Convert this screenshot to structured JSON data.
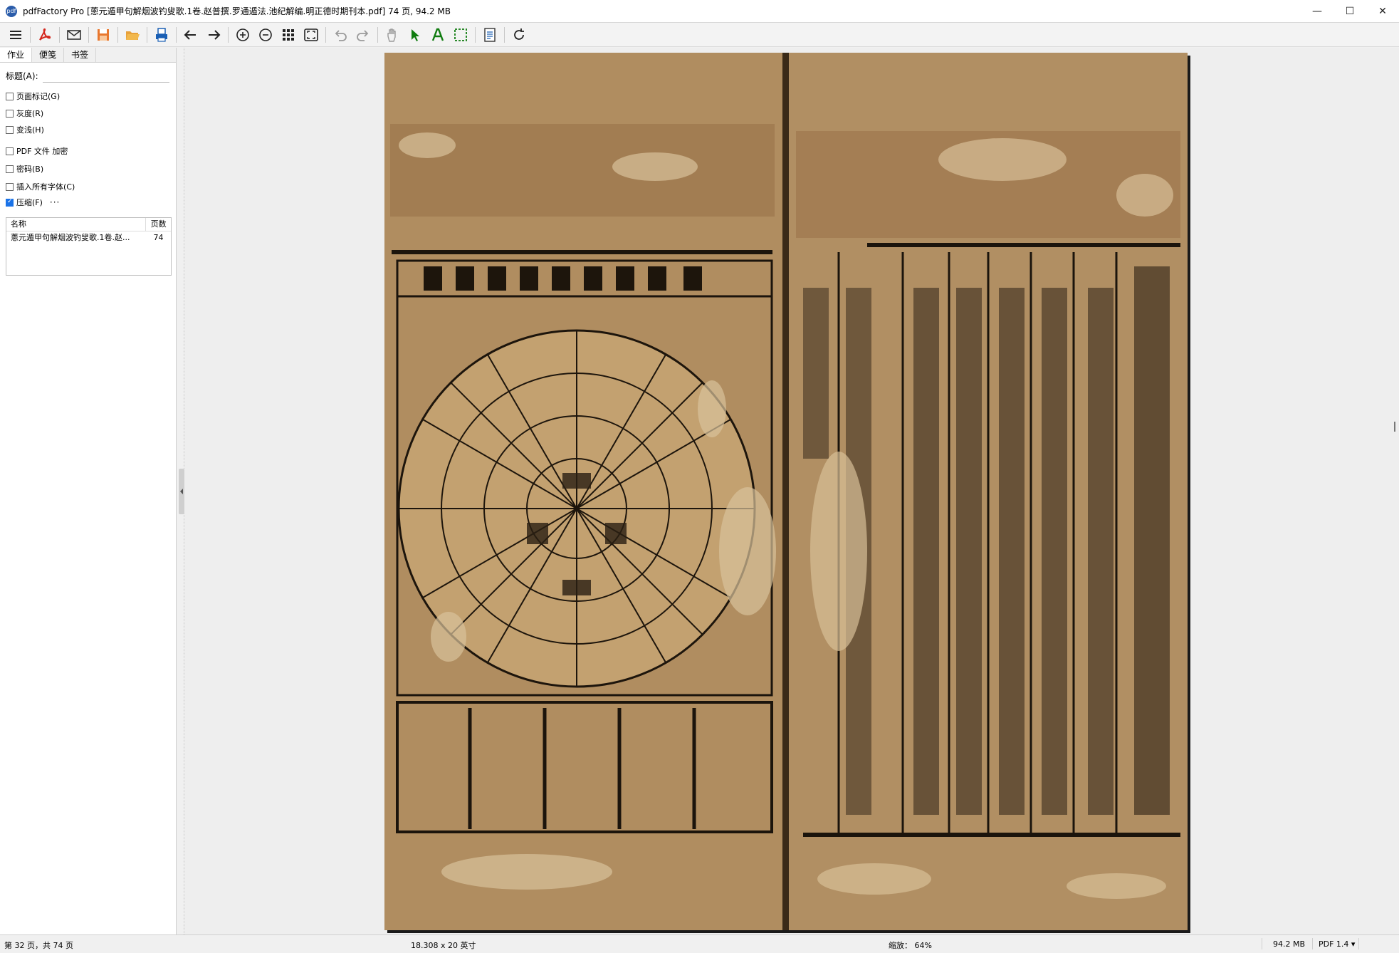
{
  "window": {
    "app_icon_text": "pdf",
    "title": "pdfFactory Pro [蔥元遁甲句解烟波钓叟歌.1卷.赵普撰.罗通遁法.池纪解编.明正德时期刊本.pdf] 74 页, 94.2 MB",
    "minimize": "—",
    "maximize": "☐",
    "close": "✕"
  },
  "toolbar": {
    "icons": [
      "menu-icon",
      "pdf-icon",
      "email-icon",
      "save-icon",
      "open-folder-icon",
      "print-icon",
      "back-arrow-icon",
      "forward-arrow-icon",
      "zoom-in-icon",
      "zoom-out-icon",
      "grid-icon",
      "fit-page-icon",
      "undo-icon",
      "redo-icon",
      "hand-tool-icon",
      "select-tool-icon",
      "text-tool-icon",
      "region-tool-icon",
      "notes-icon",
      "refresh-icon"
    ]
  },
  "left_panel": {
    "tabs": [
      "作业",
      "便笺",
      "书签"
    ],
    "title_label": "标题(A):",
    "title_value": "",
    "options": [
      {
        "label": "页面标记(G)",
        "checked": false
      },
      {
        "label": "灰度(R)",
        "checked": false
      },
      {
        "label": "变浅(H)",
        "checked": false
      },
      {
        "label": "PDF 文件 加密",
        "checked": false
      },
      {
        "label": "密码(B)",
        "checked": false
      },
      {
        "label": "插入所有字体(C)",
        "checked": false
      },
      {
        "label": "压缩(F)",
        "checked": true
      }
    ],
    "more_label": "···",
    "file_list": {
      "col_name": "名称",
      "col_pages": "页数",
      "rows": [
        {
          "name": "蔥元遁甲句解烟波钓叟歌.1卷.赵...",
          "pages": "74"
        }
      ]
    }
  },
  "status": {
    "page": "第 32 页，共 74 页",
    "size": "18.308 x 20 英寸",
    "zoom": "缩放： 64%",
    "filesize": "94.2 MB",
    "pdf_version": "PDF 1.4 ▾"
  },
  "colors": {
    "select_tool": "#107c10",
    "text_tool": "#107c10",
    "accent_orange": "#e8772e",
    "accent_blue": "#1a5fb4"
  }
}
